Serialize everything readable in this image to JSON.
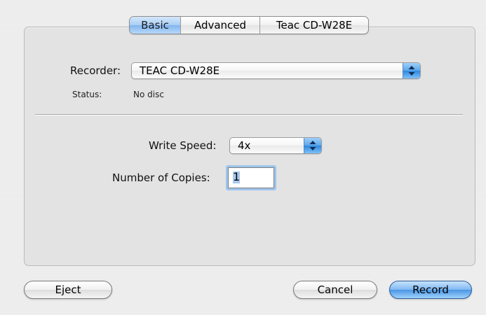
{
  "tabs": [
    {
      "label": "Basic",
      "selected": true
    },
    {
      "label": "Advanced",
      "selected": false
    },
    {
      "label": "Teac CD-W28E",
      "selected": false
    }
  ],
  "recorder": {
    "label": "Recorder:",
    "value": "TEAC CD-W28E"
  },
  "status": {
    "label": "Status:",
    "value": "No disc"
  },
  "write_speed": {
    "label": "Write Speed:",
    "value": "4x"
  },
  "copies": {
    "label": "Number of Copies:",
    "value": "1"
  },
  "buttons": {
    "eject": "Eject",
    "cancel": "Cancel",
    "record": "Record"
  },
  "colors": {
    "accent": "#4a96e4",
    "selection": "#a9c8ee"
  },
  "icons": {
    "popup_arrows": "up-down-arrows-icon"
  }
}
